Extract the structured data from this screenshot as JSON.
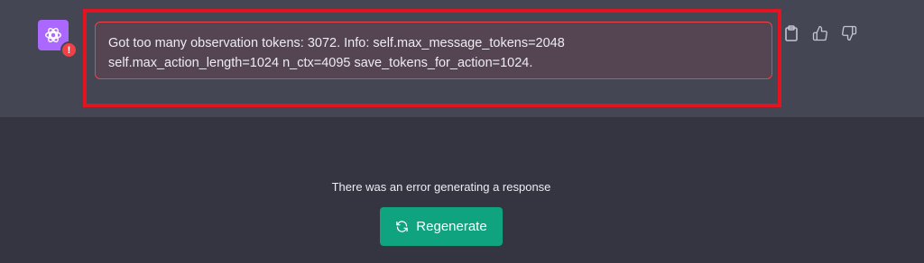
{
  "message": {
    "avatar_icon": "openai-logo-icon",
    "avatar_color": "#ab68ff",
    "error_badge_text": "!",
    "error_badge_color": "#ef4146",
    "error_lines": [
      "Got too many observation tokens: 3072. Info: self.max_message_tokens=2048",
      "self.max_action_length=1024 n_ctx=4095 save_tokens_for_action=1024."
    ],
    "highlight_color": "#e3141f"
  },
  "actions": [
    {
      "icon": "clipboard-icon"
    },
    {
      "icon": "thumbs-up-icon"
    },
    {
      "icon": "thumbs-down-icon"
    }
  ],
  "footer": {
    "error_text": "There was an error generating a response",
    "regenerate_label": "Regenerate",
    "regenerate_icon": "refresh-icon",
    "accent_color": "#10a37f"
  }
}
